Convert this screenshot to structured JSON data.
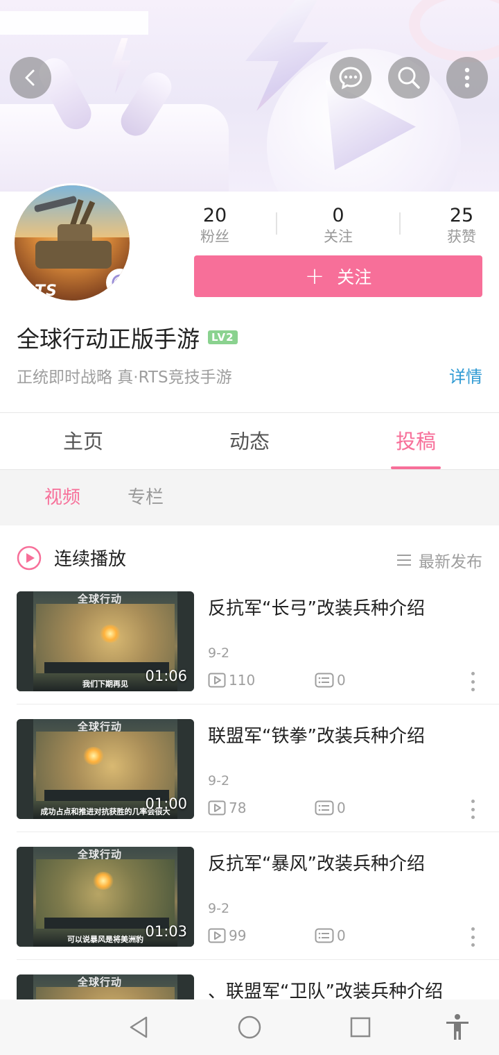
{
  "header": {
    "back_icon": "chevron-left-icon",
    "message_icon": "chat-bubble-icon",
    "search_icon": "search-icon",
    "more_icon": "more-vertical-icon"
  },
  "profile": {
    "avatar_text": "RTS",
    "name": "全球行动正版手游",
    "level": "LV2",
    "bio": "正统即时战略 真·RTS竞技手游",
    "detail_link": "详情",
    "stats": [
      {
        "value": "20",
        "label": "粉丝"
      },
      {
        "value": "0",
        "label": "关注"
      },
      {
        "value": "25",
        "label": "获赞"
      }
    ],
    "follow_button": {
      "plus": "+",
      "label": "关注"
    }
  },
  "tabs": [
    {
      "label": "主页",
      "active": false
    },
    {
      "label": "动态",
      "active": false
    },
    {
      "label": "投稿",
      "active": true
    }
  ],
  "subtabs": [
    {
      "label": "视频",
      "active": true
    },
    {
      "label": "专栏",
      "active": false
    }
  ],
  "list_header": {
    "play_all": "连续播放",
    "sort": "最新发布"
  },
  "videos": [
    {
      "title": "反抗军“长弓”改装兵种介绍",
      "date": "9-2",
      "plays": "110",
      "comments": "0",
      "duration": "01:06",
      "thumb_logo": "全球行动",
      "thumb_caption": "我们下期再见"
    },
    {
      "title": "联盟军“铁拳”改装兵种介绍",
      "date": "9-2",
      "plays": "78",
      "comments": "0",
      "duration": "01:00",
      "thumb_logo": "全球行动",
      "thumb_caption": "成功占点和推进对抗获胜的几率会很大"
    },
    {
      "title": "反抗军“暴风”改装兵种介绍",
      "date": "9-2",
      "plays": "99",
      "comments": "0",
      "duration": "01:03",
      "thumb_logo": "全球行动",
      "thumb_caption": "可以说暴风是将美洲豹"
    },
    {
      "title": "、联盟军“卫队”改装兵种介绍",
      "date": "",
      "plays": "",
      "comments": "",
      "duration": "",
      "thumb_logo": "全球行动",
      "thumb_caption": ""
    }
  ],
  "navbar": {
    "back": "triangle-back-icon",
    "home": "circle-home-icon",
    "recents": "square-recents-icon",
    "accessibility": "accessibility-icon"
  },
  "colors": {
    "accent": "#f76f99",
    "link": "#2f9ad3",
    "level_badge": "#8ad28f"
  }
}
